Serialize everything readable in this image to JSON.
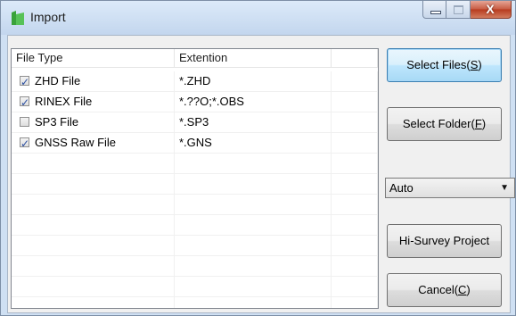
{
  "window": {
    "title": "Import",
    "close_glyph": "X",
    "icon": "app-icon",
    "caption_buttons": [
      "minimize",
      "maximize",
      "close"
    ]
  },
  "table": {
    "headers": [
      "File Type",
      "Extention",
      ""
    ],
    "rows": [
      {
        "checked": true,
        "type": "ZHD File",
        "ext": "*.ZHD"
      },
      {
        "checked": true,
        "type": "RINEX File",
        "ext": "*.??O;*.OBS"
      },
      {
        "checked": false,
        "type": "SP3 File",
        "ext": "*.SP3"
      },
      {
        "checked": true,
        "type": "GNSS Raw File",
        "ext": "*.GNS"
      },
      {
        "checked": null,
        "type": "",
        "ext": ""
      },
      {
        "checked": null,
        "type": "",
        "ext": ""
      },
      {
        "checked": null,
        "type": "",
        "ext": ""
      },
      {
        "checked": null,
        "type": "",
        "ext": ""
      },
      {
        "checked": null,
        "type": "",
        "ext": ""
      },
      {
        "checked": null,
        "type": "",
        "ext": ""
      },
      {
        "checked": null,
        "type": "",
        "ext": ""
      },
      {
        "checked": null,
        "type": "",
        "ext": ""
      }
    ]
  },
  "buttons": {
    "select_files": {
      "label": "Select Files(",
      "key": "S",
      "suffix": ")"
    },
    "select_folder": {
      "label": "Select Folder(",
      "key": "F",
      "suffix": ")"
    },
    "hi_survey": {
      "label": "Hi-Survey Project"
    },
    "cancel": {
      "label": "Cancel(",
      "key": "C",
      "suffix": ")"
    }
  },
  "mode_select": {
    "value": "Auto",
    "arrow": "▼"
  },
  "colors": {
    "accent": "#3c7fb1",
    "checkmark": "#2b4fa1",
    "close": "#c75a41"
  }
}
